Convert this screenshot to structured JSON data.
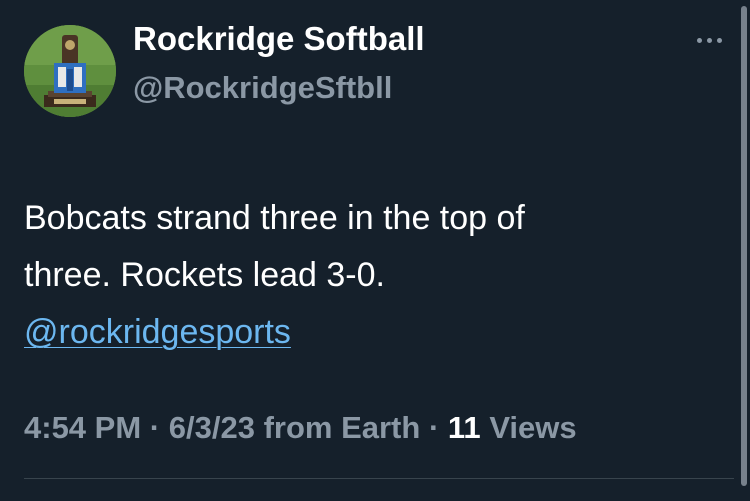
{
  "tweet": {
    "author": {
      "name": "Rockridge Softball",
      "handle": "@RockridgeSftbll"
    },
    "more_icon": "more-horizontal-icon",
    "text_lines": [
      "Bobcats strand three in the top of",
      "three. Rockets lead 3-0."
    ],
    "mention": "@rockridgesports",
    "meta": {
      "time": "4:54 PM",
      "separator": "·",
      "date": "6/3/23",
      "source": "from Earth",
      "views_count": "11",
      "views_label": "Views"
    }
  },
  "colors": {
    "background": "#15202b",
    "primary_text": "#ffffff",
    "secondary_text": "#8b98a5",
    "link": "#6cb7f0",
    "divider": "#38444d"
  }
}
